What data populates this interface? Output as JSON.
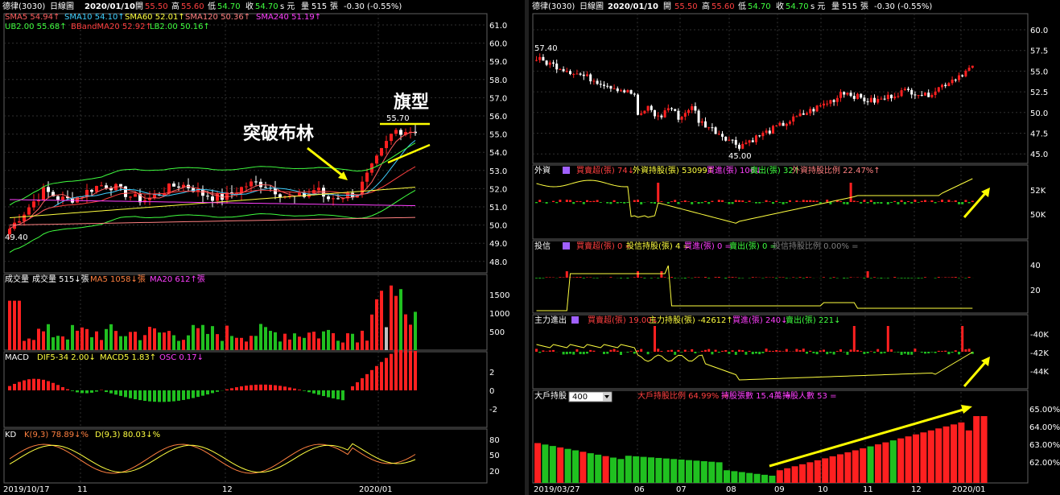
{
  "left": {
    "header": {
      "stock": "德律(3030)",
      "period": "日線圖",
      "date": "2020/01/10",
      "open_label": "開",
      "open": "55.50",
      "high_label": "高",
      "high": "55.60",
      "low_label": "低",
      "low": "54.70",
      "close_label": "收",
      "close": "54.70",
      "unit": "s 元",
      "vol_label": "量",
      "vol": "515",
      "vol_unit": "張",
      "change": "-0.30 (-0.55%)"
    },
    "ma_legend": [
      {
        "text": "SMA5 54.94↑",
        "color": "#ff6060"
      },
      {
        "text": "SMA10 54.10↑",
        "color": "#40d0ff"
      },
      {
        "text": "SMA60 52.01↑",
        "color": "#ffff40"
      },
      {
        "text": "SMA120 50.36↑",
        "color": "#ff8080"
      },
      {
        "text": "SMA240 51.19↑",
        "color": "#ff40ff"
      }
    ],
    "bb_legend": [
      {
        "text": "UB2.00 55.68↑",
        "color": "#40ff40"
      },
      {
        "text": "BBandMA20 52.92↑",
        "color": "#ff4040"
      },
      {
        "text": "LB2.00 50.16↑",
        "color": "#40ff40"
      }
    ],
    "price_axis": [
      "61.0",
      "60.0",
      "59.0",
      "58.0",
      "57.0",
      "56.0",
      "55.0",
      "54.0",
      "53.0",
      "52.0",
      "51.0",
      "50.0",
      "49.0",
      "48.0"
    ],
    "price_low_label": "49.40",
    "price_high_label": "55.70",
    "annotation_breakout": "突破布林",
    "annotation_flag": "旗型",
    "vol_panel": {
      "title": "成交量",
      "vol_text": "成交量 515↓張",
      "ma5": "MA5 1058↓張",
      "ma20": "MA20 612↑張",
      "axis": [
        "1500",
        "1000",
        "500"
      ]
    },
    "macd_panel": {
      "title": "MACD",
      "dif": "DIF5-34 2.00↓",
      "macd": "MACD5 1.83↑",
      "osc": "OSC 0.17↓",
      "axis": [
        "2",
        "0",
        "-2"
      ]
    },
    "kd_panel": {
      "title": "KD",
      "k": "K(9,3) 78.89↓%",
      "d": "D(9,3) 80.03↓%",
      "axis": [
        "80",
        "50",
        "20"
      ]
    },
    "date_axis": [
      "2019/10/17",
      "11",
      "12",
      "2020/01"
    ]
  },
  "right": {
    "header": {
      "stock": "德律(3030)",
      "period": "日線圖",
      "date": "2020/01/10",
      "open_label": "開",
      "open": "55.50",
      "high_label": "高",
      "high": "55.60",
      "low_label": "低",
      "low": "54.70",
      "close_label": "收",
      "close": "54.70",
      "unit": "s 元",
      "vol_label": "量",
      "vol": "515",
      "vol_unit": "張",
      "change": "-0.30 (-0.55%)"
    },
    "price_axis": [
      "60.0",
      "57.5",
      "55.0",
      "52.5",
      "50.0",
      "47.5",
      "45.0"
    ],
    "price_high_label": "57.40",
    "price_low_label": "45.00",
    "foreign": {
      "title": "外資",
      "buy": "買賣超(張) 74↓",
      "hold": "外資持股(張) 53099↑",
      "in": "買進(張) 106↓",
      "out": "賣出(張) 32↑",
      "ratio": "外資持股比例 22.47%↑",
      "axis": [
        "52K",
        "50K"
      ]
    },
    "trust": {
      "title": "投信",
      "buy": "買賣超(張) 0 =",
      "hold": "投信持股(張) 4 =",
      "in": "買進(張) 0 =",
      "out": "賣出(張) 0 =",
      "ratio": "投信持股比例 0.00% =",
      "axis": [
        "40",
        "20"
      ]
    },
    "main": {
      "title": "主力進出",
      "buy": "買賣超(張) 19.00↓",
      "hold": "主力持股(張) -42612↑",
      "in": "買進(張) 240↓",
      "out": "賣出(張) 221↓",
      "axis": [
        "-40K",
        "-42K",
        "-44K"
      ]
    },
    "big": {
      "title": "大戶持股",
      "select": "400",
      "ratio": "大戶持股比例 64.99% =",
      "count": "持股張數 15.4萬 =",
      "people": "持股人數 53 =",
      "axis": [
        "65.00%",
        "64.00%",
        "63.00%",
        "62.00%"
      ]
    },
    "date_axis": [
      "2019/03/27",
      "06",
      "07",
      "08",
      "09",
      "10",
      "11",
      "12",
      "2020/01"
    ]
  },
  "colors": {
    "up": "#ff2020",
    "down": "#20c020",
    "neutral": "#c0c0c0",
    "grid": "#404040",
    "arrow": "#ffff00"
  },
  "chart_data": [
    {
      "type": "line",
      "title": "德律(3030) 日線圖",
      "ylim": [
        47.5,
        61.5
      ],
      "x": "2019/10/17 – 2020/01/10",
      "series": [
        {
          "name": "SMA5",
          "last": 54.94
        },
        {
          "name": "SMA10",
          "last": 54.1
        },
        {
          "name": "SMA60",
          "last": 52.01
        },
        {
          "name": "SMA120",
          "last": 50.36
        },
        {
          "name": "SMA240",
          "last": 51.19
        },
        {
          "name": "UB2.00",
          "last": 55.68
        },
        {
          "name": "BBandMA20",
          "last": 52.92
        },
        {
          "name": "LB2.00",
          "last": 50.16
        }
      ],
      "annotations": [
        "49.40",
        "55.70"
      ]
    },
    {
      "type": "bar",
      "title": "大戶持股",
      "ylim": [
        61.5,
        65.5
      ],
      "x": "2019/03/27 – 2020/01",
      "last": 64.99
    }
  ]
}
